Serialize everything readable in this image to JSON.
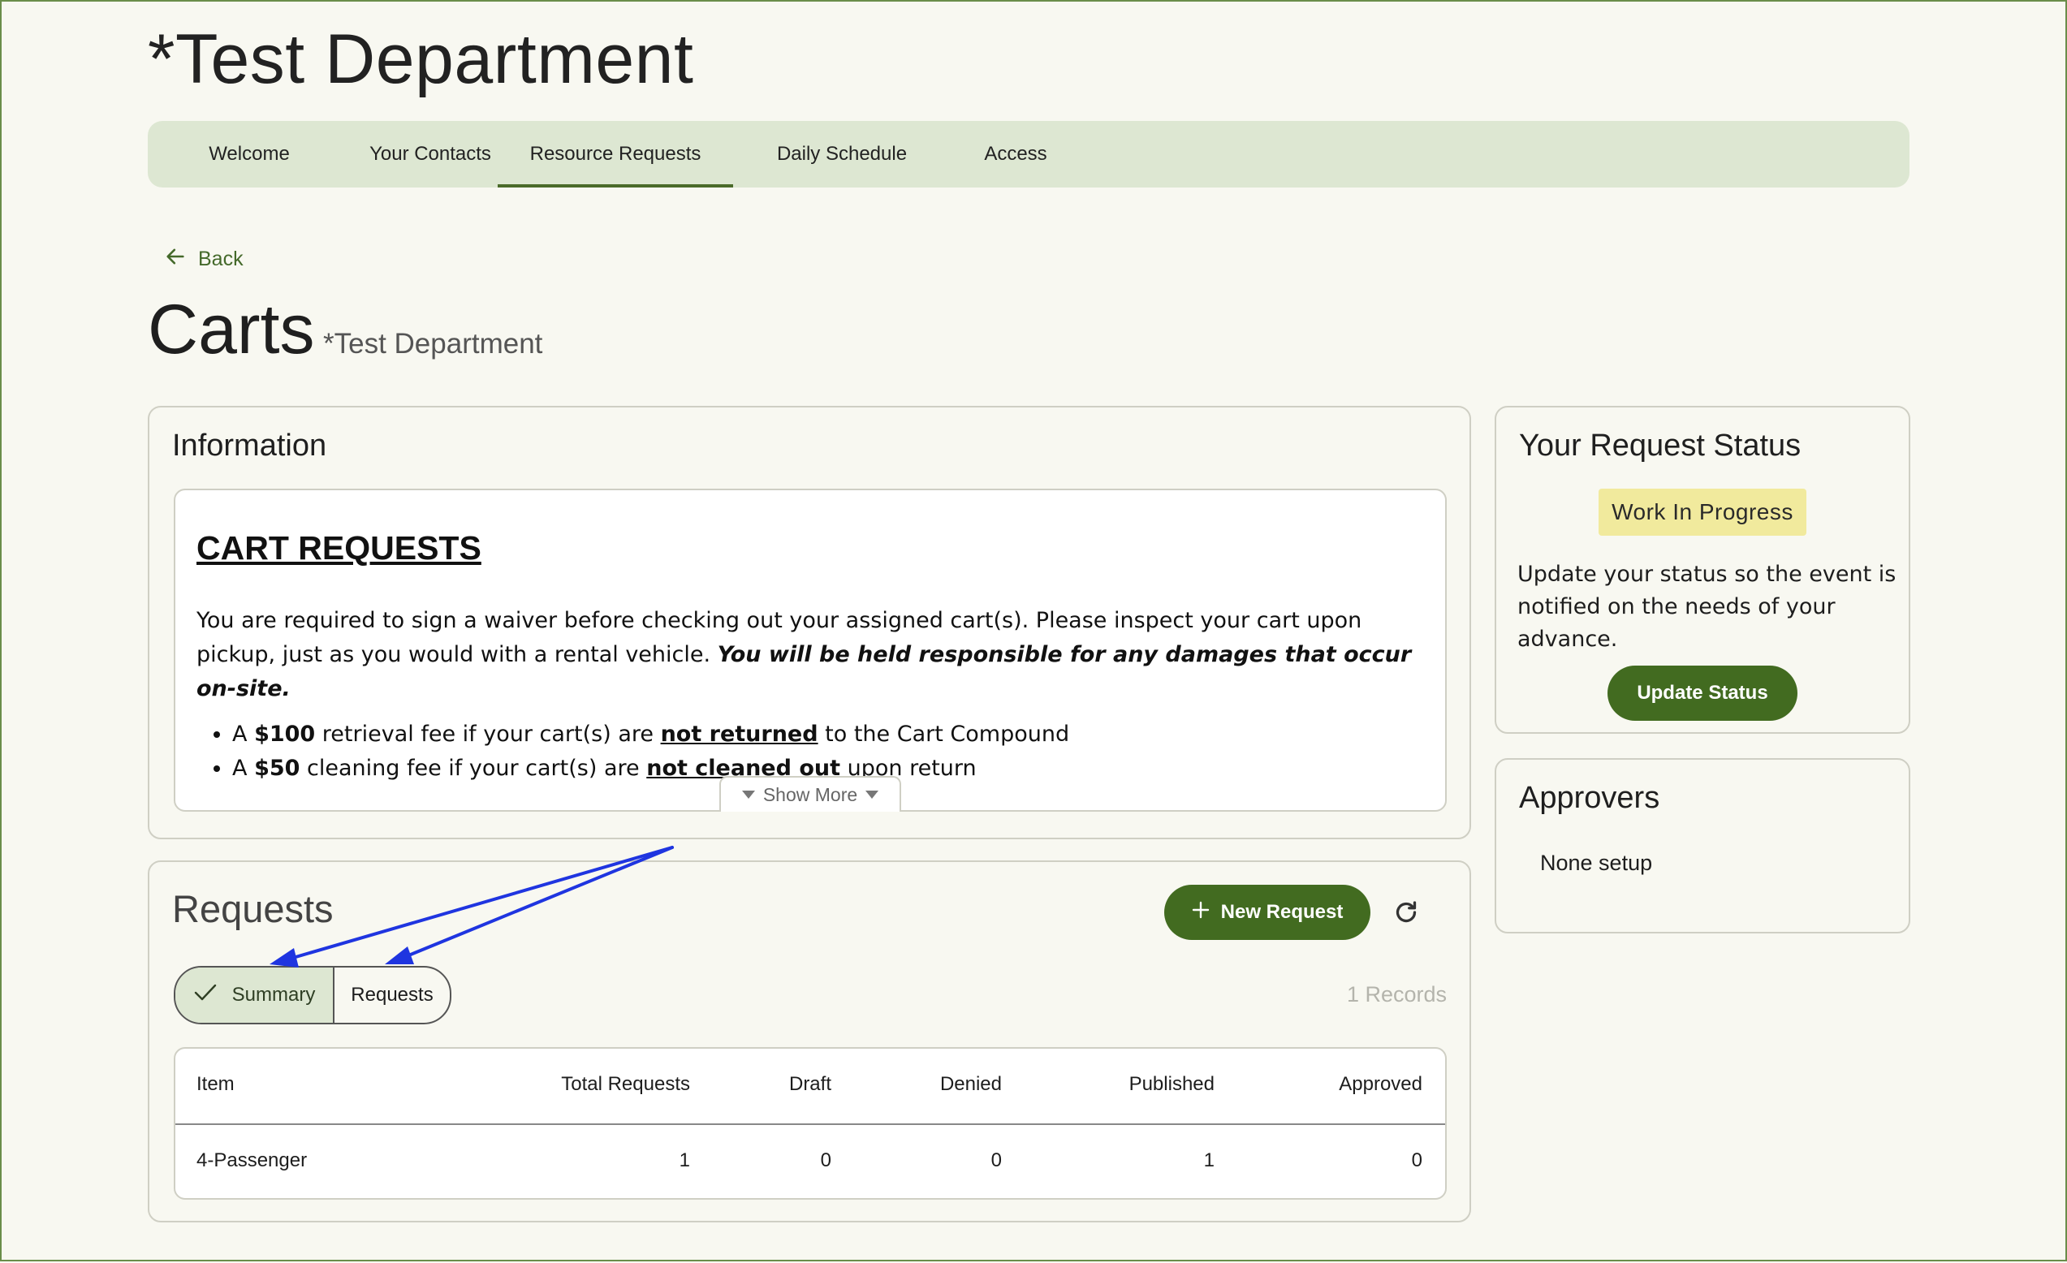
{
  "header": {
    "department_title": "*Test Department"
  },
  "nav": {
    "items": [
      "Welcome",
      "Your Contacts",
      "Resource Requests",
      "Daily Schedule",
      "Access"
    ],
    "active": "Resource Requests"
  },
  "back": {
    "label": "Back"
  },
  "page": {
    "title": "Carts",
    "subtitle": "*Test Department"
  },
  "information": {
    "title": "Information",
    "heading": "CART REQUESTS",
    "para_part1": "You are required to sign a waiver before checking out your assigned cart(s). Please inspect your cart upon pickup, just as you would with a rental vehicle. ",
    "para_emphasis": "You will be held responsible for any damages that occur on-site.",
    "bullet1": {
      "prefix": "A ",
      "amount": "$100",
      "middle": " retrieval fee if your cart(s) are ",
      "emph": "not returned",
      "suffix": " to the Cart Compound"
    },
    "bullet2": {
      "prefix": "A ",
      "amount": "$50",
      "middle": " cleaning fee if your cart(s) are ",
      "emph": "not cleaned out",
      "suffix": " upon return"
    },
    "show_more": "Show More"
  },
  "requests": {
    "title": "Requests",
    "new_request_label": "New Request",
    "segments": {
      "summary": "Summary",
      "requests": "Requests",
      "selected": "Summary"
    },
    "records_label": "1 Records",
    "table": {
      "columns": [
        "Item",
        "Total Requests",
        "Draft",
        "Denied",
        "Published",
        "Approved"
      ],
      "rows": [
        [
          "4-Passenger",
          "1",
          "0",
          "0",
          "1",
          "0"
        ]
      ]
    }
  },
  "status": {
    "title": "Your Request Status",
    "badge": "Work In Progress",
    "description": "Update your status so the event is notified on the needs of your advance.",
    "update_button": "Update Status"
  },
  "approvers": {
    "title": "Approvers",
    "text": "None setup"
  },
  "colors": {
    "accent": "#426b20",
    "nav_bg": "#dde7d2",
    "badge_bg": "#f1ea9d",
    "annotation_arrow": "#1f35e0",
    "page_bg": "#f8f8f1"
  },
  "icons": {
    "back": "arrow-left-icon",
    "add": "plus-icon",
    "refresh": "refresh-icon",
    "check": "check-icon",
    "show_more": "caret-down-icon"
  }
}
